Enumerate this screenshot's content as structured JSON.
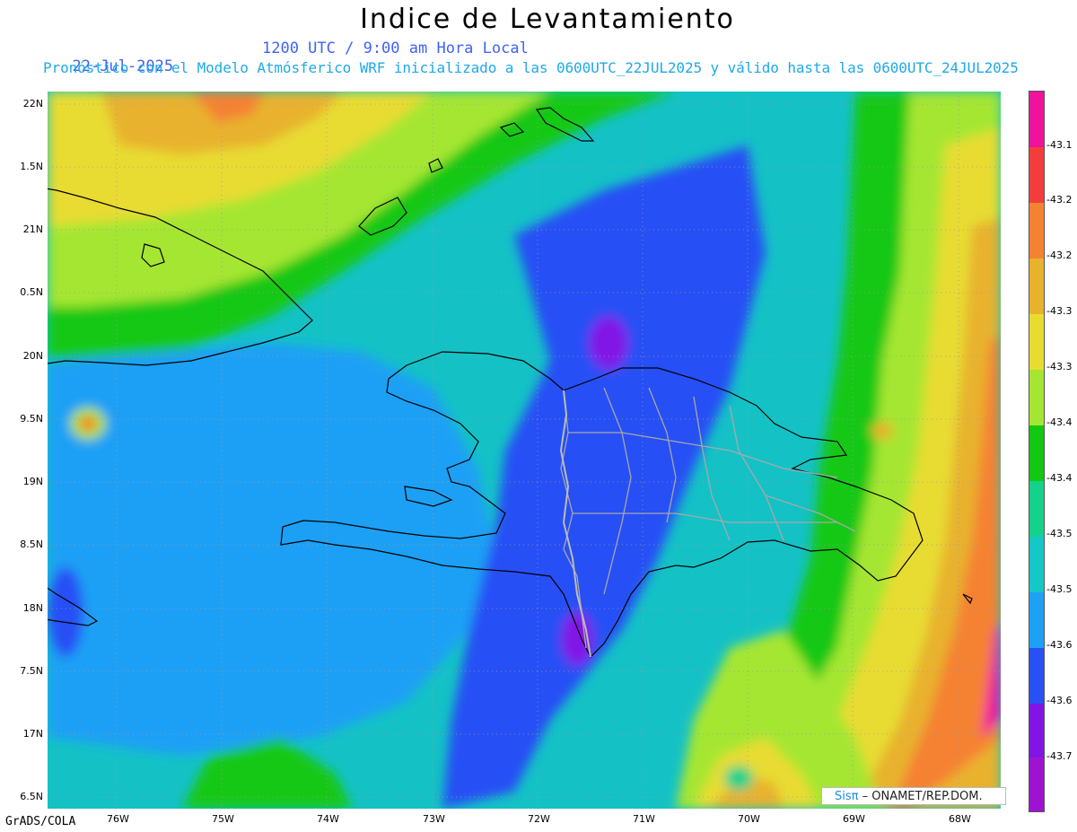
{
  "header": {
    "title": "Indice de Levantamiento",
    "date": "22-Jul-2025",
    "time_label": "1200 UTC / 9:00 am Hora Local",
    "description": "Pronóstico con el Modelo Atmósferico WRF inicializado a las 0600UTC_22JUL2025 y válido hasta las  0600UTC_24JUL2025"
  },
  "axes": {
    "lat_labels": [
      "22N",
      "1.5N",
      "21N",
      "0.5N",
      "20N",
      "9.5N",
      "19N",
      "8.5N",
      "18N",
      "7.5N",
      "17N",
      "6.5N"
    ],
    "lon_labels": [
      "76W",
      "75W",
      "74W",
      "73W",
      "72W",
      "71W",
      "70W",
      "69W",
      "68W"
    ]
  },
  "colorbar": {
    "labels": [
      "-43.1",
      "-43.2",
      "-43.2",
      "-43.3",
      "-43.3",
      "-43.4",
      "-43.4",
      "-43.5",
      "-43.5",
      "-43.6",
      "-43.6",
      "-43.7"
    ],
    "colors": [
      "#f0129c",
      "#f53c3c",
      "#f58232",
      "#e8b22e",
      "#e8dc30",
      "#a5e632",
      "#12c812",
      "#14d28c",
      "#14c8c8",
      "#1ea0f5",
      "#2850f5",
      "#8214e6",
      "#a012d2"
    ]
  },
  "footer": {
    "credit": "GrADS/COLA",
    "brand_sis": "Sisπ",
    "brand_text": " – ONAMET/REP.DOM."
  }
}
